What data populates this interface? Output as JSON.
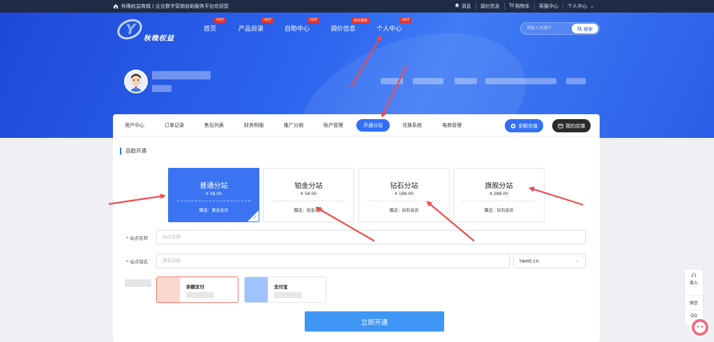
{
  "topbar": {
    "welcome": "秋晚权益商城丨企业数字营销自助服务平台欢迎您",
    "links": [
      "消息",
      "调价信息",
      "购物车",
      "客服中心",
      "个人中心"
    ]
  },
  "brand": {
    "logo_text": "秋晚权益"
  },
  "nav": [
    {
      "label": "首页",
      "badge": "HOT"
    },
    {
      "label": "产品目录",
      "badge": "HOT"
    },
    {
      "label": "自助中心",
      "badge": "HOT"
    },
    {
      "label": "调价信息",
      "badge": "实时更新"
    },
    {
      "label": "个人中心",
      "badge": "HOT"
    }
  ],
  "search": {
    "placeholder": "请输入关键字",
    "button": "搜索"
  },
  "tabs": [
    "用户中心",
    "订单记录",
    "售后列表",
    "财务明细",
    "推广分销",
    "账户管理",
    "开通分站",
    "兑换系统",
    "电商管理"
  ],
  "active_tab": "开通分站",
  "buttons": {
    "recharge": "余额充值",
    "shop": "我的店铺"
  },
  "section_title": "自助开通",
  "plans": [
    {
      "name": "普通分站",
      "price": "¥ 38.00",
      "gift": "赠送：黄金会员",
      "selected": true
    },
    {
      "name": "铂金分站",
      "price": "¥ 58.00",
      "gift": "赠送：铂金会员",
      "selected": false
    },
    {
      "name": "钻石分站",
      "price": "¥ 188.00",
      "gift": "赠送：钻石会员",
      "selected": false
    },
    {
      "name": "旗舰分站",
      "price": "¥ 288.00",
      "gift": "赠送：钻石会员",
      "selected": false
    }
  ],
  "form": {
    "site_name_label": "站点名称",
    "site_name_placeholder": "站点名称",
    "domain_label": "站点域名",
    "domain_placeholder": "域名前缀",
    "domain_suffix": "tweit.cn"
  },
  "payments": [
    {
      "name": "余额支付",
      "selected": true,
      "color": "#fcd8cf"
    },
    {
      "name": "支付宝",
      "selected": false,
      "color": "#9fc3ff"
    }
  ],
  "submit": "立即开通",
  "sidebar": {
    "items": [
      "接入",
      "微信",
      "QQ"
    ]
  },
  "colors": {
    "primary": "#3271f7",
    "hot": "#e8322f",
    "arrow": "#ef4b4b",
    "submit": "#3f96f5"
  }
}
